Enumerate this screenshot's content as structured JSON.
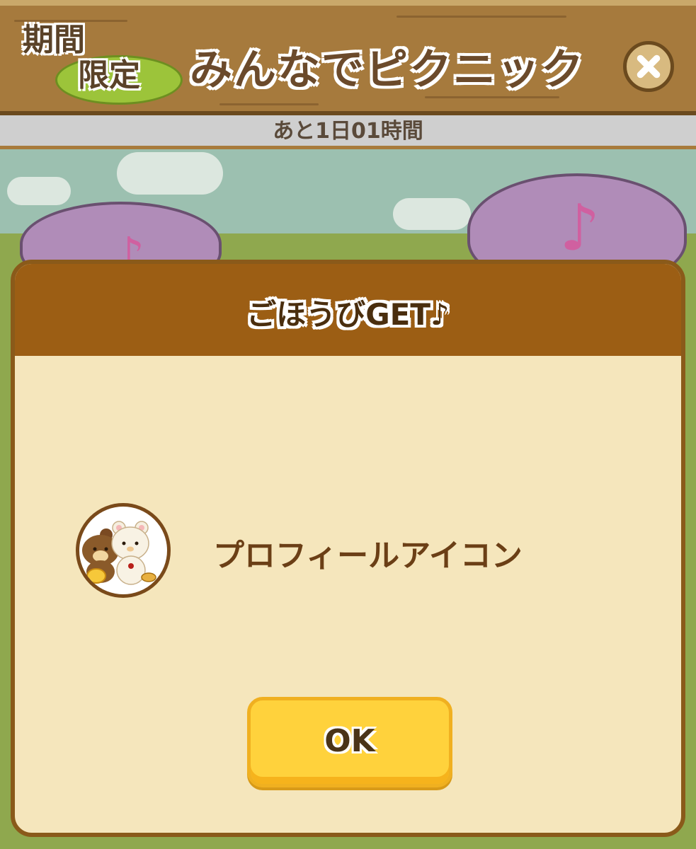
{
  "header": {
    "badge_line1": "期間",
    "badge_line2": "限定",
    "title": "みんなでピクニック",
    "close_icon": "close-icon"
  },
  "timer": {
    "text": "あと1日01時間"
  },
  "dialog": {
    "title": "ごほうびGET♪",
    "reward": {
      "icon": "rilakkuma-profile-icon",
      "label": "プロフィールアイコン"
    },
    "ok_label": "OK"
  },
  "colors": {
    "header_wood": "#a67a3d",
    "dialog_header": "#9c5e14",
    "dialog_body": "#f5e6bc",
    "ok_button": "#ffd23c"
  }
}
